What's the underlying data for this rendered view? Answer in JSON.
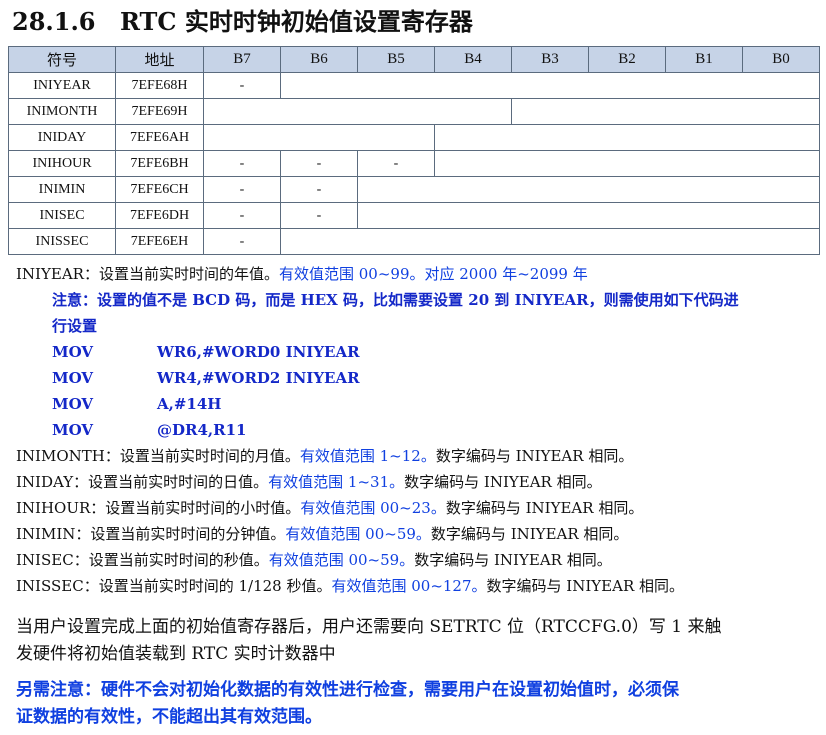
{
  "section": {
    "number": "28.1.6",
    "title": "RTC 实时时钟初始值设置寄存器"
  },
  "table": {
    "headers": [
      "符号",
      "地址",
      "B7",
      "B6",
      "B5",
      "B4",
      "B3",
      "B2",
      "B1",
      "B0"
    ],
    "rows": [
      {
        "symbol": "INIYEAR",
        "address": "7EFE68H",
        "dashes": 1,
        "splits": []
      },
      {
        "symbol": "INIMONTH",
        "address": "7EFE69H",
        "dashes": 0,
        "splits": [
          4
        ]
      },
      {
        "symbol": "INIDAY",
        "address": "7EFE6AH",
        "dashes": 0,
        "splits": [
          3
        ]
      },
      {
        "symbol": "INIHOUR",
        "address": "7EFE6BH",
        "dashes": 3,
        "splits": []
      },
      {
        "symbol": "INIMIN",
        "address": "7EFE6CH",
        "dashes": 2,
        "splits": []
      },
      {
        "symbol": "INISEC",
        "address": "7EFE6DH",
        "dashes": 2,
        "splits": []
      },
      {
        "symbol": "INISSEC",
        "address": "7EFE6EH",
        "dashes": 1,
        "splits": []
      }
    ],
    "dash": "-"
  },
  "desc": {
    "iniyear": {
      "name": "INIYEAR",
      "text": "：设置当前实时时间的年值。",
      "range": "有效值范围 00~99。对应 2000 年~2099 年"
    },
    "note1": "注意：设置的值不是 BCD 码，而是 HEX 码，比如需要设置 20 到 INIYEAR，则需使用如下代码进",
    "note2": "行设置",
    "code": [
      {
        "op": "MOV",
        "args": "WR6,#WORD0 INIYEAR"
      },
      {
        "op": "MOV",
        "args": "WR4,#WORD2 INIYEAR"
      },
      {
        "op": "MOV",
        "args": "A,#14H"
      },
      {
        "op": "MOV",
        "args": "@DR4,R11"
      }
    ],
    "others": [
      {
        "name": "INIMONTH",
        "text": "：设置当前实时时间的月值。",
        "range": "有效值范围 1~12。",
        "tail": "数字编码与 INIYEAR 相同。"
      },
      {
        "name": "INIDAY",
        "text": "：设置当前实时时间的日值。",
        "range": "有效值范围 1~31。",
        "tail": "数字编码与 INIYEAR 相同。"
      },
      {
        "name": "INIHOUR",
        "text": "：设置当前实时时间的小时值。",
        "range": "有效值范围 00~23。",
        "tail": "数字编码与 INIYEAR 相同。"
      },
      {
        "name": "INIMIN",
        "text": "：设置当前实时时间的分钟值。",
        "range": "有效值范围 00~59。",
        "tail": "数字编码与 INIYEAR 相同。"
      },
      {
        "name": "INISEC",
        "text": "：设置当前实时时间的秒值。",
        "range": "有效值范围 00~59。",
        "tail": "数字编码与 INIYEAR 相同。"
      },
      {
        "name": "INISSEC",
        "text": "：设置当前实时时间的 1/128 秒值。",
        "range": "有效值范围 00~127。",
        "tail": "数字编码与 INIYEAR 相同。"
      }
    ]
  },
  "paragraph1": [
    "当用户设置完成上面的初始值寄存器后，用户还需要向 SETRTC 位（RTCCFG.0）写 1 来触",
    "发硬件将初始值装载到 RTC 实时计数器中"
  ],
  "paragraph2": [
    "另需注意：硬件不会对初始化数据的有效性进行检查，需要用户在设置初始值时，必须保",
    "证数据的有效性，不能超出其有效范围。"
  ]
}
